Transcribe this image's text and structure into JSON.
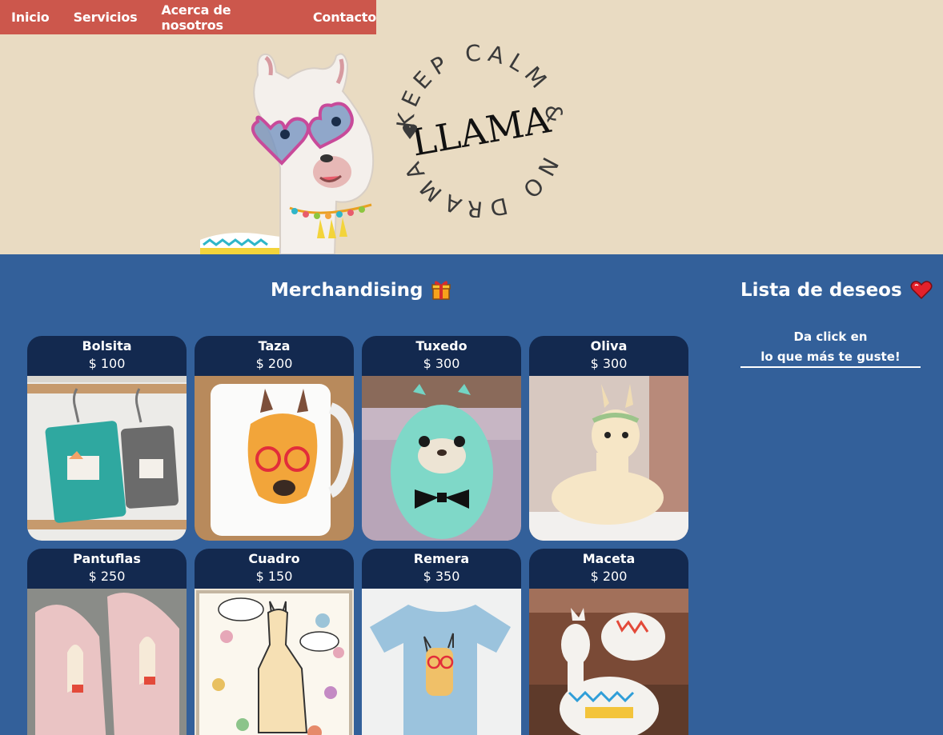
{
  "nav": {
    "items": [
      {
        "label": "Inicio"
      },
      {
        "label": "Servicios"
      },
      {
        "label": "Acerca de nosotros"
      },
      {
        "label": "Contacto"
      }
    ]
  },
  "hero": {
    "logo_top_text": "KEEP CALM &",
    "logo_bottom_text": "NO DRAMA",
    "logo_center_text": "LLAMA"
  },
  "merch": {
    "title": "Merchandising",
    "title_icon": "gift-icon",
    "products": [
      {
        "name": "Bolsita",
        "price": "$ 100",
        "image": "llama-coin-purses"
      },
      {
        "name": "Taza",
        "price": "$ 200",
        "image": "llama-mug"
      },
      {
        "name": "Tuxedo",
        "price": "$ 300",
        "image": "plush-llama-bowtie"
      },
      {
        "name": "Oliva",
        "price": "$ 300",
        "image": "plush-llama-flower-crown"
      },
      {
        "name": "Pantuflas",
        "price": "$ 250",
        "image": "llama-slippers"
      },
      {
        "name": "Cuadro",
        "price": "$ 150",
        "image": "llama-painting"
      },
      {
        "name": "Remera",
        "price": "$ 350",
        "image": "llama-tshirt"
      },
      {
        "name": "Maceta",
        "price": "$ 200",
        "image": "llama-planter"
      }
    ]
  },
  "wishlist": {
    "title": "Lista de deseos",
    "title_icon": "heart-icon",
    "hint_line1": "Da click en",
    "hint_line2": "lo que más te guste!"
  },
  "colors": {
    "nav_bg": "#cc574c",
    "hero_bg": "#e9dbc2",
    "page_bg": "#33609a",
    "card_head_bg": "#13294f"
  }
}
